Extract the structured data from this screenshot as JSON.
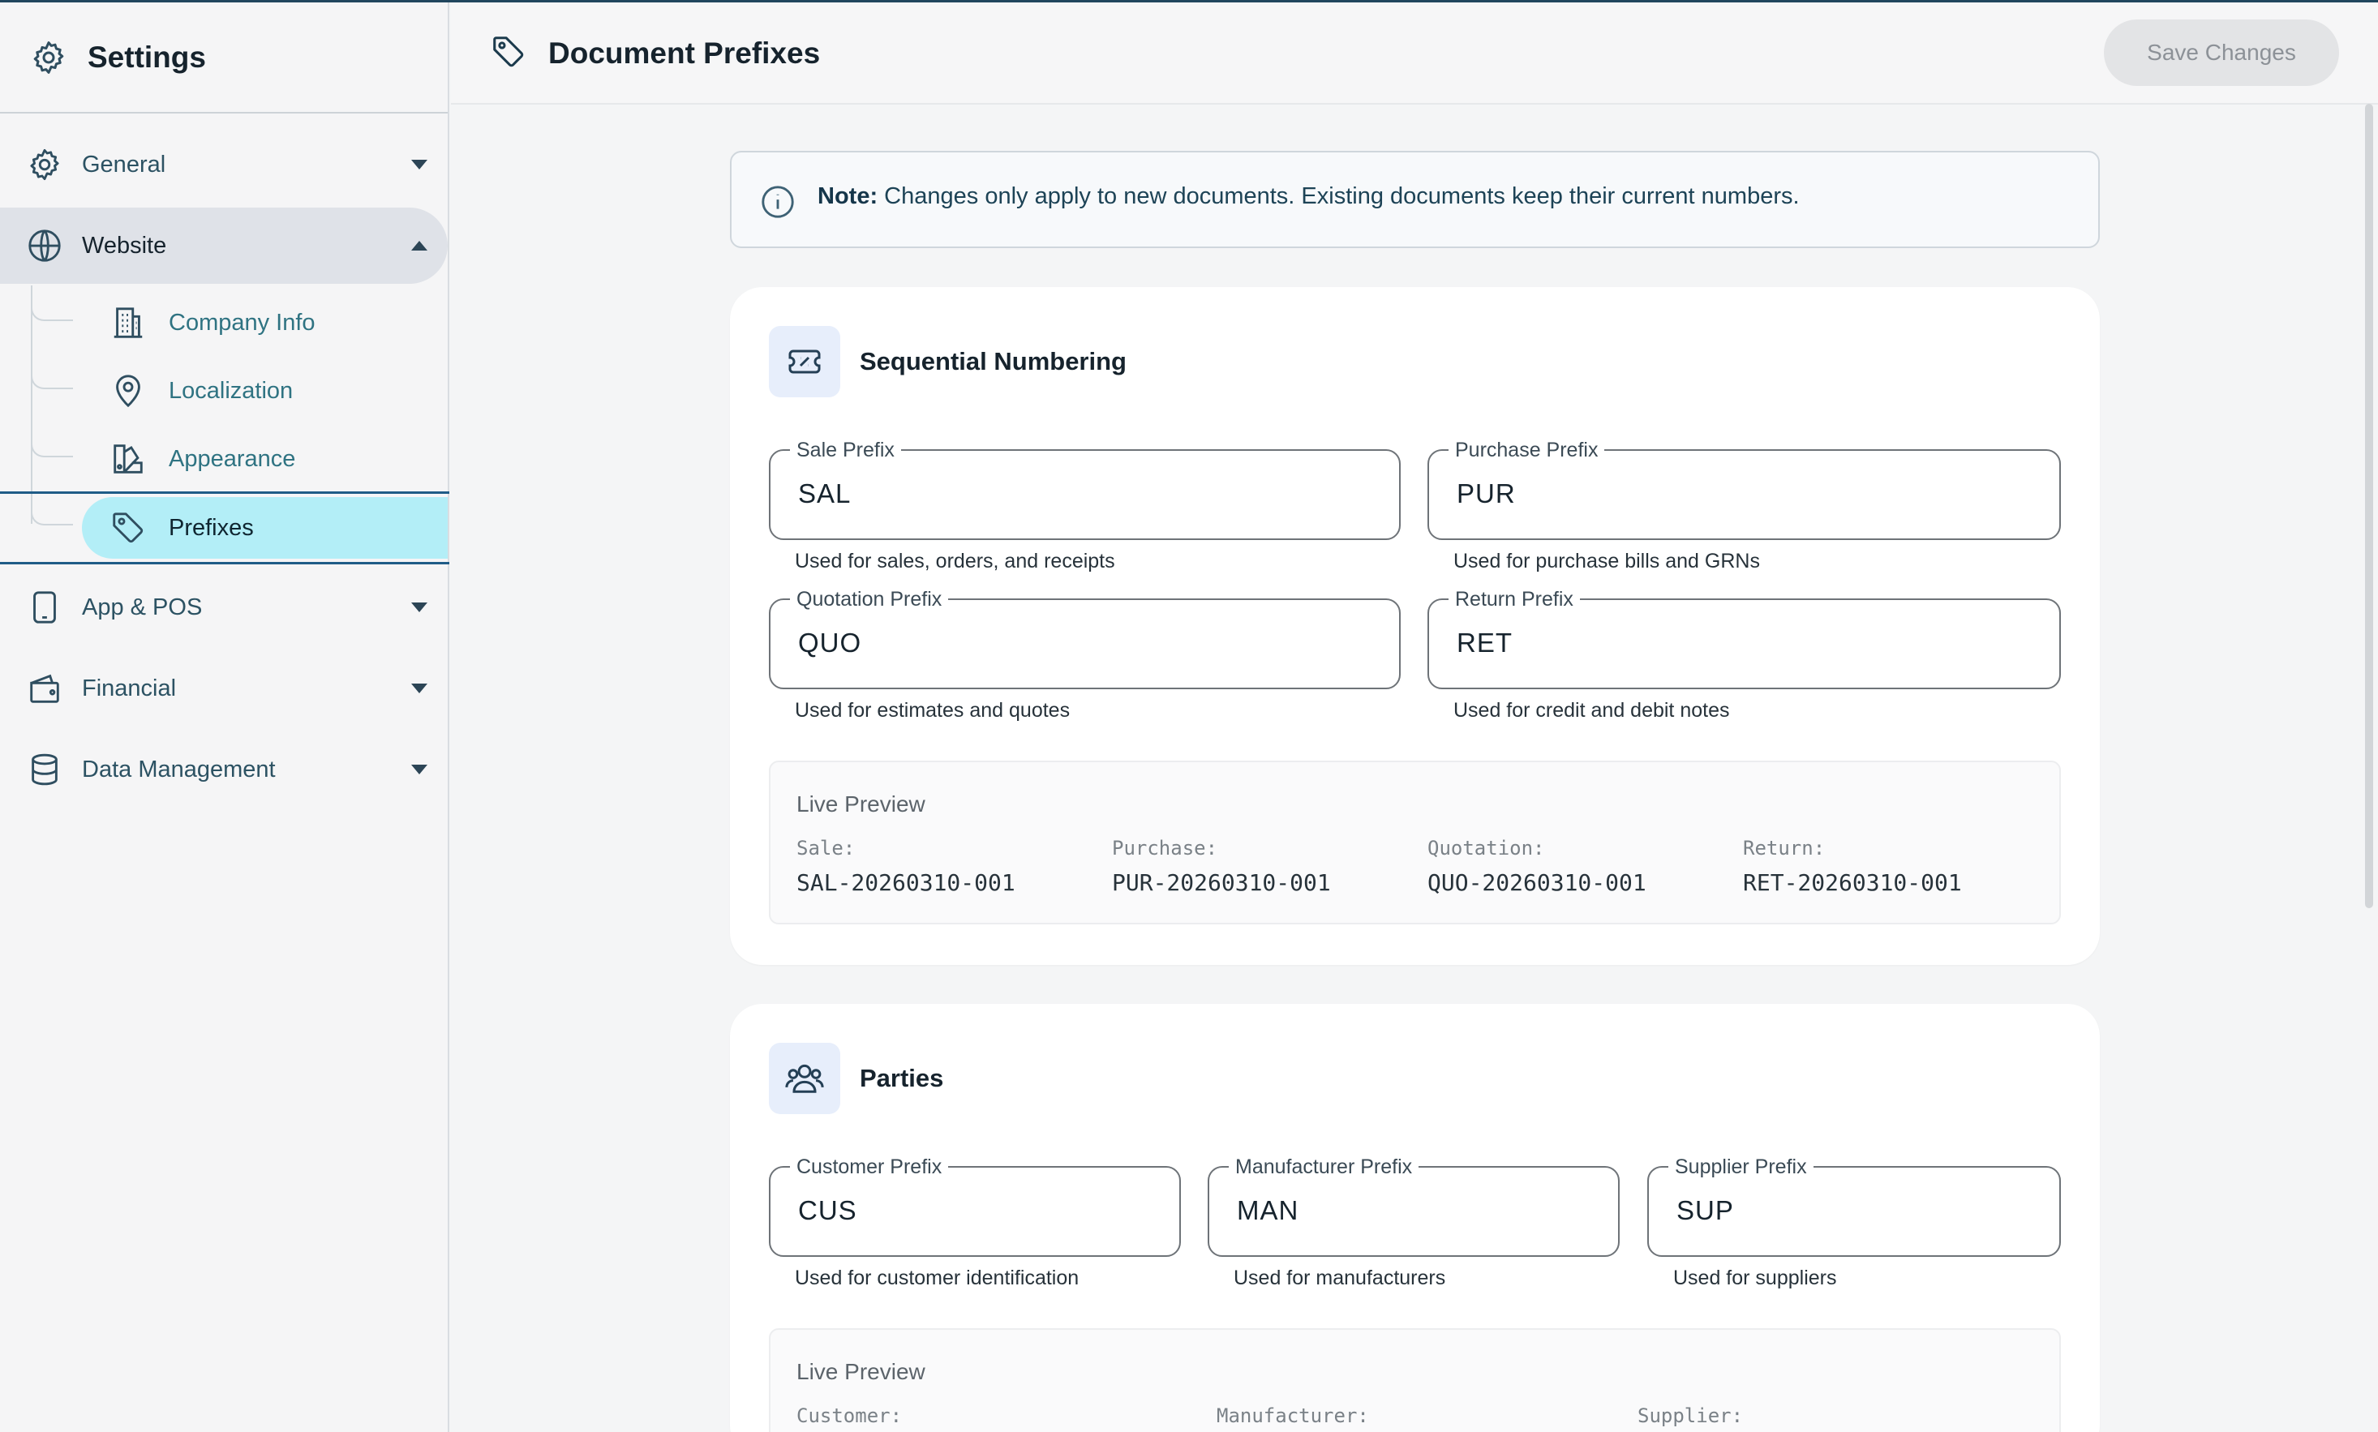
{
  "sidebar": {
    "title": "Settings",
    "items": [
      {
        "label": "General"
      },
      {
        "label": "Website"
      },
      {
        "label": "App & POS"
      },
      {
        "label": "Financial"
      },
      {
        "label": "Data Management"
      }
    ],
    "website_sub": [
      {
        "label": "Company Info"
      },
      {
        "label": "Localization"
      },
      {
        "label": "Appearance"
      },
      {
        "label": "Prefixes"
      }
    ]
  },
  "header": {
    "title": "Document Prefixes",
    "save_label": "Save Changes"
  },
  "note": {
    "bold": "Note:",
    "text": "Changes only apply to new documents. Existing documents keep their current numbers."
  },
  "sequential": {
    "title": "Sequential Numbering",
    "fields": [
      {
        "label": "Sale Prefix",
        "value": "SAL",
        "helper": "Used for sales, orders, and receipts"
      },
      {
        "label": "Purchase Prefix",
        "value": "PUR",
        "helper": "Used for purchase bills and GRNs"
      },
      {
        "label": "Quotation Prefix",
        "value": "QUO",
        "helper": "Used for estimates and quotes"
      },
      {
        "label": "Return Prefix",
        "value": "RET",
        "helper": "Used for credit and debit notes"
      }
    ],
    "preview": {
      "title": "Live Preview",
      "items": [
        {
          "label": "Sale:",
          "value": "SAL-20260310-001"
        },
        {
          "label": "Purchase:",
          "value": "PUR-20260310-001"
        },
        {
          "label": "Quotation:",
          "value": "QUO-20260310-001"
        },
        {
          "label": "Return:",
          "value": "RET-20260310-001"
        }
      ]
    }
  },
  "parties": {
    "title": "Parties",
    "fields": [
      {
        "label": "Customer Prefix",
        "value": "CUS",
        "helper": "Used for customer identification"
      },
      {
        "label": "Manufacturer Prefix",
        "value": "MAN",
        "helper": "Used for manufacturers"
      },
      {
        "label": "Supplier Prefix",
        "value": "SUP",
        "helper": "Used for suppliers"
      }
    ],
    "preview": {
      "title": "Live Preview",
      "items": [
        {
          "label": "Customer:"
        },
        {
          "label": "Manufacturer:"
        },
        {
          "label": "Supplier:"
        }
      ]
    }
  },
  "colors": {
    "accent": "#1f5c87",
    "active_pill": "#b3eef7",
    "open_group": "#dfe2e8"
  }
}
